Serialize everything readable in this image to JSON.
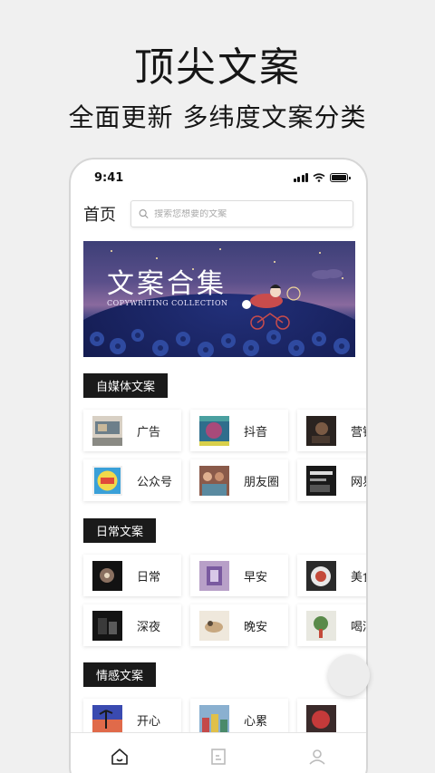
{
  "promo": {
    "headline": "顶尖文案",
    "subline": "全面更新  多纬度文案分类"
  },
  "status": {
    "time": "9:41"
  },
  "topbar": {
    "title": "首页",
    "search_placeholder": "搜索您想要的文案"
  },
  "banner": {
    "title": "文案合集",
    "subtitle": "COPYWRITING COLLECTION"
  },
  "sections": [
    {
      "label": "自媒体文案",
      "rows": [
        [
          {
            "label": "广告",
            "icon": "billboard-photo"
          },
          {
            "label": "抖音",
            "icon": "portrait-photo"
          },
          {
            "label": "营销",
            "icon": "dark-photo"
          }
        ],
        [
          {
            "label": "公众号",
            "icon": "badge-photo"
          },
          {
            "label": "朋友圈",
            "icon": "group-photo"
          },
          {
            "label": "网易",
            "icon": "bw-photo"
          }
        ]
      ]
    },
    {
      "label": "日常文案",
      "rows": [
        [
          {
            "label": "日常",
            "icon": "flower-photo"
          },
          {
            "label": "早安",
            "icon": "purple-photo"
          },
          {
            "label": "美食",
            "icon": "food-photo"
          }
        ],
        [
          {
            "label": "深夜",
            "icon": "night-photo"
          },
          {
            "label": "晚安",
            "icon": "sketch-photo"
          },
          {
            "label": "喝酒",
            "icon": "plant-photo"
          }
        ]
      ]
    },
    {
      "label": "情感文案",
      "rows": [
        [
          {
            "label": "开心",
            "icon": "sunset-photo"
          },
          {
            "label": "心累",
            "icon": "city-photo"
          },
          {
            "label": "",
            "icon": "red-photo"
          }
        ]
      ]
    }
  ],
  "tabs": [
    "home-icon",
    "document-icon",
    "user-icon"
  ],
  "colors": {
    "tag_bg": "#1a1a1a",
    "banner_purple": "#3d3f77"
  }
}
